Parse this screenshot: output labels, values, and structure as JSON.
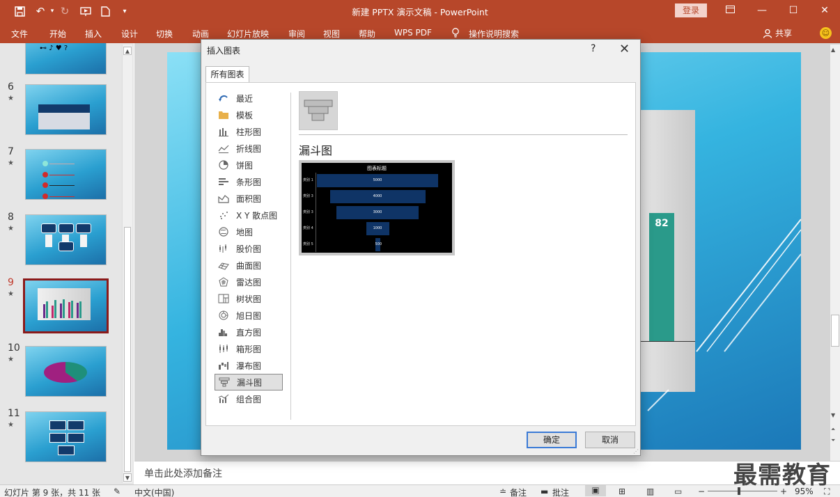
{
  "window": {
    "title": "新建 PPTX 演示文稿 - PowerPoint",
    "login": "登录"
  },
  "ribbon": {
    "tabs": [
      "文件",
      "开始",
      "插入",
      "设计",
      "切换",
      "动画",
      "幻灯片放映",
      "审阅",
      "视图",
      "帮助",
      "WPS PDF"
    ],
    "tell_me": "操作说明搜索",
    "share": "共享"
  },
  "thumbnails": [
    {
      "num": "6",
      "star": "★"
    },
    {
      "num": "7",
      "star": "★"
    },
    {
      "num": "8",
      "star": "★"
    },
    {
      "num": "9",
      "star": "★"
    },
    {
      "num": "10",
      "star": "★"
    },
    {
      "num": "11",
      "star": "★"
    }
  ],
  "slide": {
    "visible_label": "82"
  },
  "notes_placeholder": "单击此处添加备注",
  "status": {
    "slide_info": "幻灯片 第 9 张，共 11 张",
    "language": "中文(中国)",
    "notes_btn": "备注",
    "comments_btn": "批注",
    "zoom": "95%"
  },
  "dialog": {
    "title": "插入图表",
    "help": "?",
    "tab": "所有图表",
    "categories": [
      {
        "label": "最近",
        "icon": "recent-icon"
      },
      {
        "label": "模板",
        "icon": "folder-icon"
      },
      {
        "label": "柱形图",
        "icon": "column-chart-icon"
      },
      {
        "label": "折线图",
        "icon": "line-chart-icon"
      },
      {
        "label": "饼图",
        "icon": "pie-chart-icon"
      },
      {
        "label": "条形图",
        "icon": "bar-chart-icon"
      },
      {
        "label": "面积图",
        "icon": "area-chart-icon"
      },
      {
        "label": "X Y 散点图",
        "icon": "scatter-chart-icon"
      },
      {
        "label": "地图",
        "icon": "map-chart-icon"
      },
      {
        "label": "股价图",
        "icon": "stock-chart-icon"
      },
      {
        "label": "曲面图",
        "icon": "surface-chart-icon"
      },
      {
        "label": "雷达图",
        "icon": "radar-chart-icon"
      },
      {
        "label": "树状图",
        "icon": "treemap-chart-icon"
      },
      {
        "label": "旭日图",
        "icon": "sunburst-chart-icon"
      },
      {
        "label": "直方图",
        "icon": "histogram-chart-icon"
      },
      {
        "label": "箱形图",
        "icon": "boxwhisker-chart-icon"
      },
      {
        "label": "瀑布图",
        "icon": "waterfall-chart-icon"
      },
      {
        "label": "漏斗图",
        "icon": "funnel-chart-icon"
      },
      {
        "label": "组合图",
        "icon": "combo-chart-icon"
      }
    ],
    "selected_category": "漏斗图",
    "chart_type_title": "漏斗图",
    "preview": {
      "title": "图表标题",
      "rows": [
        {
          "label": "类别 1",
          "value": "5000"
        },
        {
          "label": "类别 3",
          "value": "4000"
        },
        {
          "label": "类别 3",
          "value": "3000"
        },
        {
          "label": "类别 4",
          "value": "1000"
        },
        {
          "label": "类别 5",
          "value": "500"
        }
      ]
    },
    "ok": "确定",
    "cancel": "取消"
  },
  "watermark": "最需教育"
}
